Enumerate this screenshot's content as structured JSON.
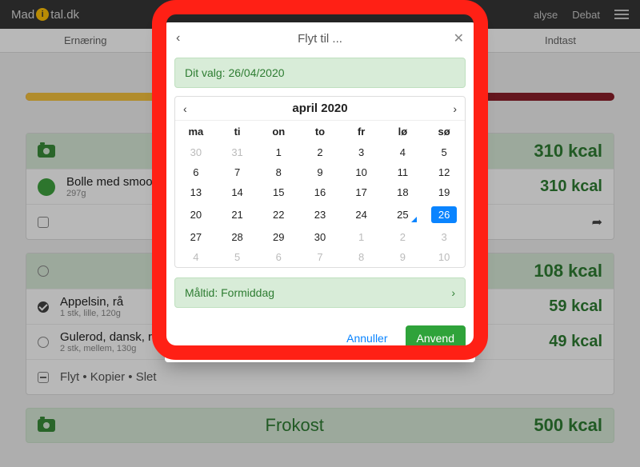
{
  "top": {
    "brand_pre": "Mad",
    "brand_post": "tal.dk",
    "nav_analyse": "alyse",
    "nav_debat": "Debat"
  },
  "subnav": {
    "left": "Ernæring",
    "right": "Indtast"
  },
  "meal1": {
    "header_kcal": "310 kcal",
    "item_name": "Bolle med smooth",
    "item_sub": "297g",
    "item_kcal": "310 kcal"
  },
  "meal2": {
    "header_kcal": "108 kcal",
    "i1_name": "Appelsin, rå",
    "i1_sub": "1 stk, lille, 120g",
    "i1_kcal": "59 kcal",
    "i2_name": "Gulerod, dansk, rå",
    "i2_sub": "2 stk, mellem, 130g",
    "i2_kcal": "49 kcal",
    "actions": "Flyt • Kopier • Slet"
  },
  "frokost": {
    "title": "Frokost",
    "kcal": "500 kcal"
  },
  "modal": {
    "title": "Flyt til ...",
    "selection_prefix": "Dit valg: ",
    "selection_date": "26/04/2020",
    "month": "april 2020",
    "weekdays": [
      "ma",
      "ti",
      "on",
      "to",
      "fr",
      "lø",
      "sø"
    ],
    "weeks": [
      [
        {
          "d": "30",
          "dim": true
        },
        {
          "d": "31",
          "dim": true
        },
        {
          "d": "1"
        },
        {
          "d": "2"
        },
        {
          "d": "3"
        },
        {
          "d": "4"
        },
        {
          "d": "5"
        }
      ],
      [
        {
          "d": "6"
        },
        {
          "d": "7"
        },
        {
          "d": "8"
        },
        {
          "d": "9"
        },
        {
          "d": "10"
        },
        {
          "d": "11"
        },
        {
          "d": "12"
        }
      ],
      [
        {
          "d": "13"
        },
        {
          "d": "14"
        },
        {
          "d": "15"
        },
        {
          "d": "16"
        },
        {
          "d": "17"
        },
        {
          "d": "18"
        },
        {
          "d": "19"
        }
      ],
      [
        {
          "d": "20"
        },
        {
          "d": "21"
        },
        {
          "d": "22"
        },
        {
          "d": "23"
        },
        {
          "d": "24"
        },
        {
          "d": "25",
          "mark": true
        },
        {
          "d": "26",
          "sel": true
        }
      ],
      [
        {
          "d": "27"
        },
        {
          "d": "28"
        },
        {
          "d": "29"
        },
        {
          "d": "30"
        },
        {
          "d": "1",
          "dim": true
        },
        {
          "d": "2",
          "dim": true
        },
        {
          "d": "3",
          "dim": true
        }
      ],
      [
        {
          "d": "4",
          "dim": true
        },
        {
          "d": "5",
          "dim": true
        },
        {
          "d": "6",
          "dim": true
        },
        {
          "d": "7",
          "dim": true
        },
        {
          "d": "8",
          "dim": true
        },
        {
          "d": "9",
          "dim": true
        },
        {
          "d": "10",
          "dim": true
        }
      ]
    ],
    "meal_label": "Måltid: Formiddag",
    "cancel": "Annuller",
    "apply": "Anvend"
  }
}
